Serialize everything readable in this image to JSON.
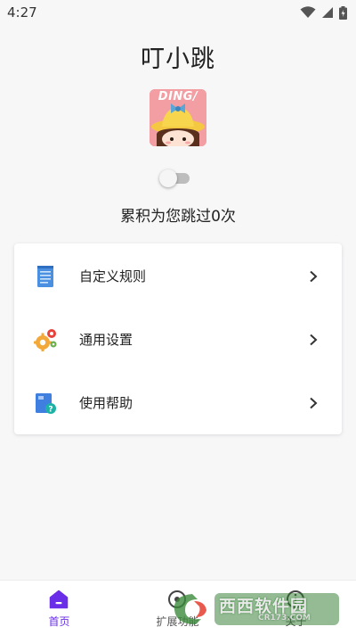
{
  "status_bar": {
    "time": "4:27",
    "icons": [
      "wifi-icon",
      "signal-icon",
      "battery-charging-icon"
    ]
  },
  "header": {
    "app_title": "叮小跳",
    "logo_text": "DING/"
  },
  "service": {
    "enabled": false,
    "count_text": "累积为您跳过0次"
  },
  "menu": {
    "items": [
      {
        "label": "自定义规则",
        "icon": "rules-document-icon"
      },
      {
        "label": "通用设置",
        "icon": "settings-gears-icon"
      },
      {
        "label": "使用帮助",
        "icon": "help-book-icon"
      }
    ]
  },
  "bottom_nav": {
    "items": [
      {
        "label": "首页",
        "icon": "home-icon",
        "active": true
      },
      {
        "label": "扩展功能",
        "icon": "extension-icon",
        "active": false
      },
      {
        "label": "关于",
        "icon": "about-icon",
        "active": false
      }
    ]
  },
  "watermark": {
    "text": "西西软件园",
    "sub": "CR173.COM"
  },
  "colors": {
    "accent": "#6a2ee8",
    "background": "#f7f7f8",
    "card": "#ffffff",
    "toggle_off": "#bdbdbd"
  }
}
